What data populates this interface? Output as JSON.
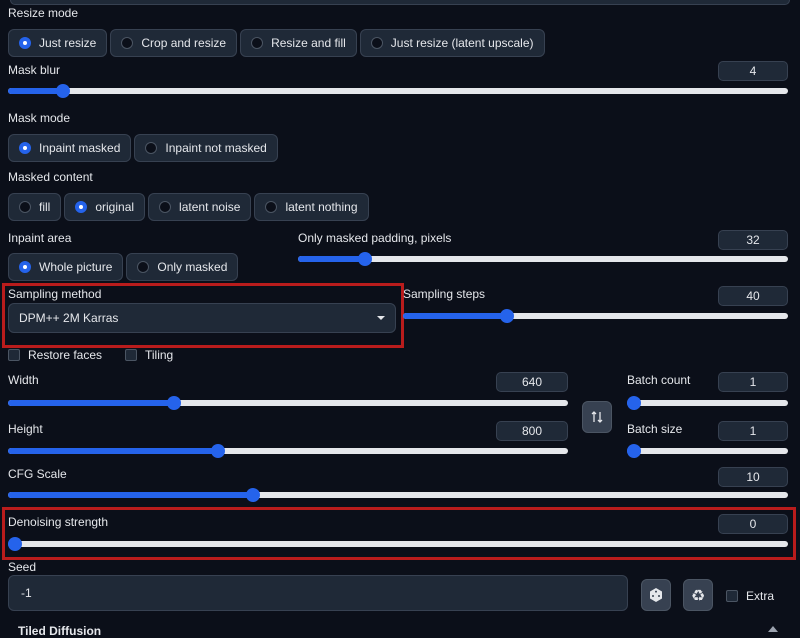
{
  "resize_mode": {
    "label": "Resize mode",
    "options": [
      "Just resize",
      "Crop and resize",
      "Resize and fill",
      "Just resize (latent upscale)"
    ],
    "selected": "Just resize"
  },
  "mask_blur": {
    "label": "Mask blur",
    "value": "4",
    "min": 0,
    "max": 64
  },
  "mask_mode": {
    "label": "Mask mode",
    "options": [
      "Inpaint masked",
      "Inpaint not masked"
    ],
    "selected": "Inpaint masked"
  },
  "masked_content": {
    "label": "Masked content",
    "options": [
      "fill",
      "original",
      "latent noise",
      "latent nothing"
    ],
    "selected": "original"
  },
  "inpaint_area": {
    "label": "Inpaint area",
    "options": [
      "Whole picture",
      "Only masked"
    ],
    "selected": "Whole picture"
  },
  "only_masked_padding": {
    "label": "Only masked padding, pixels",
    "value": "32",
    "min": 0,
    "max": 256
  },
  "sampling_method": {
    "label": "Sampling method",
    "value": "DPM++ 2M Karras"
  },
  "sampling_steps": {
    "label": "Sampling steps",
    "value": "40",
    "min": 1,
    "max": 150
  },
  "restore_faces": {
    "label": "Restore faces",
    "checked": false
  },
  "tiling": {
    "label": "Tiling",
    "checked": false
  },
  "width": {
    "label": "Width",
    "value": "640",
    "min": 64,
    "max": 2048
  },
  "height": {
    "label": "Height",
    "value": "800",
    "min": 64,
    "max": 2048
  },
  "batch_count": {
    "label": "Batch count",
    "value": "1",
    "min": 1,
    "max": 100
  },
  "batch_size": {
    "label": "Batch size",
    "value": "1",
    "min": 1,
    "max": 8
  },
  "swap_icon": "swap-vertical-arrows",
  "cfg_scale": {
    "label": "CFG Scale",
    "value": "10",
    "min": 1,
    "max": 30
  },
  "denoising_strength": {
    "label": "Denoising strength",
    "value": "0",
    "min": 0,
    "max": 1
  },
  "seed": {
    "label": "Seed",
    "value": "-1"
  },
  "seed_buttons": {
    "random_icon": "dice-icon",
    "reuse_icon": "recycle-icon"
  },
  "extra": {
    "label": "Extra",
    "checked": false
  },
  "bottom_section": {
    "label": "Tiled Diffusion"
  },
  "colors": {
    "accent": "#2563eb",
    "highlight": "#b91c1c",
    "background": "#0b0f19",
    "panel": "#1f2937"
  }
}
